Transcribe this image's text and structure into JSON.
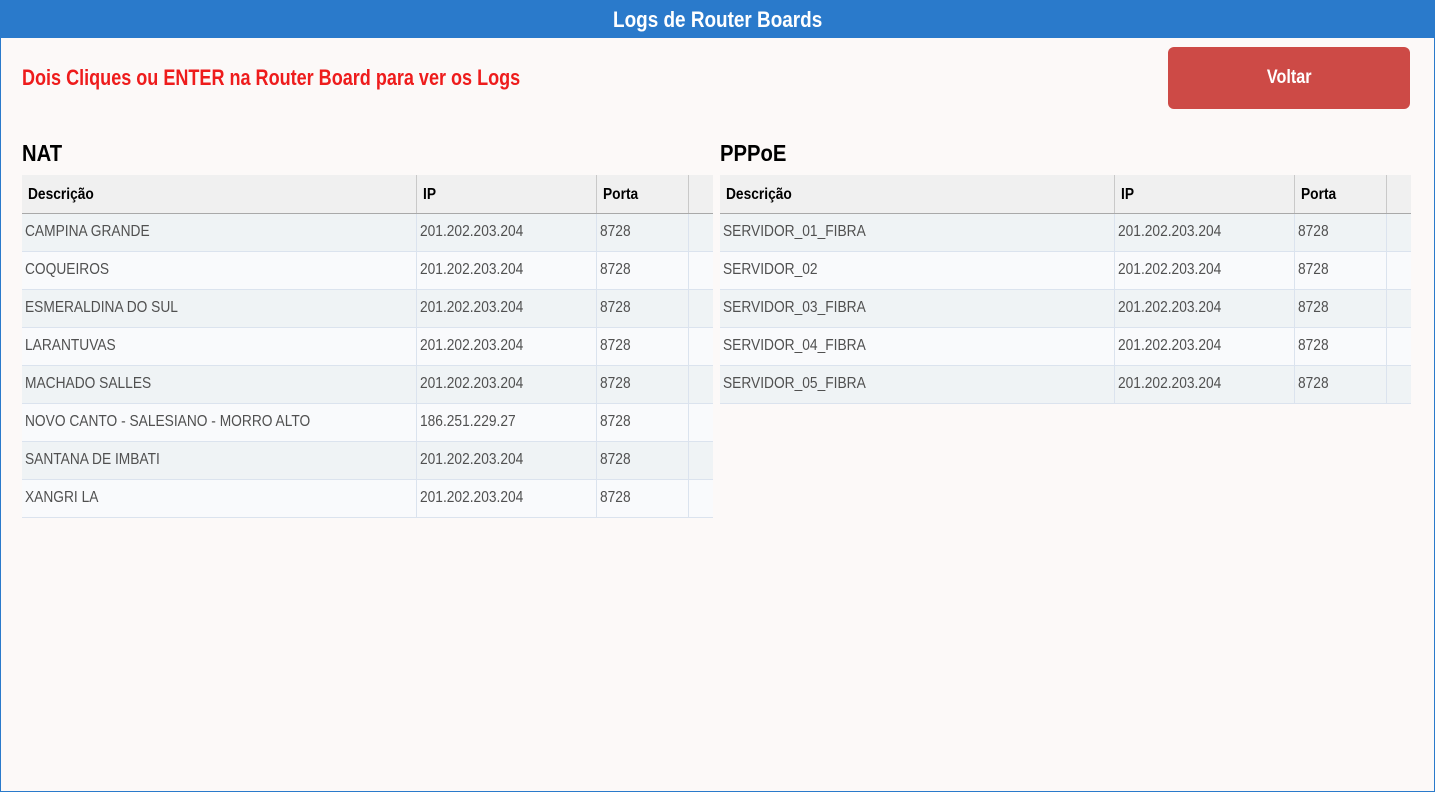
{
  "window": {
    "title": "Logs de Router Boards"
  },
  "instruction": "Dois Cliques ou ENTER na Router Board para ver os Logs",
  "back_button": {
    "label": "Voltar"
  },
  "nat": {
    "title": "NAT",
    "columns": [
      "Descrição",
      "IP",
      "Porta"
    ],
    "rows": [
      {
        "desc": "CAMPINA GRANDE",
        "ip": "201.202.203.204",
        "port": "8728"
      },
      {
        "desc": "COQUEIROS",
        "ip": "201.202.203.204",
        "port": "8728"
      },
      {
        "desc": "ESMERALDINA DO SUL",
        "ip": "201.202.203.204",
        "port": "8728"
      },
      {
        "desc": "LARANTUVAS",
        "ip": "201.202.203.204",
        "port": "8728"
      },
      {
        "desc": "MACHADO SALLES",
        "ip": "201.202.203.204",
        "port": "8728"
      },
      {
        "desc": "NOVO CANTO - SALESIANO - MORRO ALTO",
        "ip": "186.251.229.27",
        "port": "8728"
      },
      {
        "desc": "SANTANA DE IMBATI",
        "ip": "201.202.203.204",
        "port": "8728"
      },
      {
        "desc": "XANGRI LA",
        "ip": "201.202.203.204",
        "port": "8728"
      }
    ]
  },
  "pppoe": {
    "title": "PPPoE",
    "columns": [
      "Descrição",
      "IP",
      "Porta"
    ],
    "rows": [
      {
        "desc": "SERVIDOR_01_FIBRA",
        "ip": "201.202.203.204",
        "port": "8728"
      },
      {
        "desc": "SERVIDOR_02",
        "ip": "201.202.203.204",
        "port": "8728"
      },
      {
        "desc": "SERVIDOR_03_FIBRA",
        "ip": "201.202.203.204",
        "port": "8728"
      },
      {
        "desc": "SERVIDOR_04_FIBRA",
        "ip": "201.202.203.204",
        "port": "8728"
      },
      {
        "desc": "SERVIDOR_05_FIBRA",
        "ip": "201.202.203.204",
        "port": "8728"
      }
    ]
  },
  "colors": {
    "titlebar": "#2a7acb",
    "instruction": "#ee1c1c",
    "back_button": "#cd4a46"
  }
}
